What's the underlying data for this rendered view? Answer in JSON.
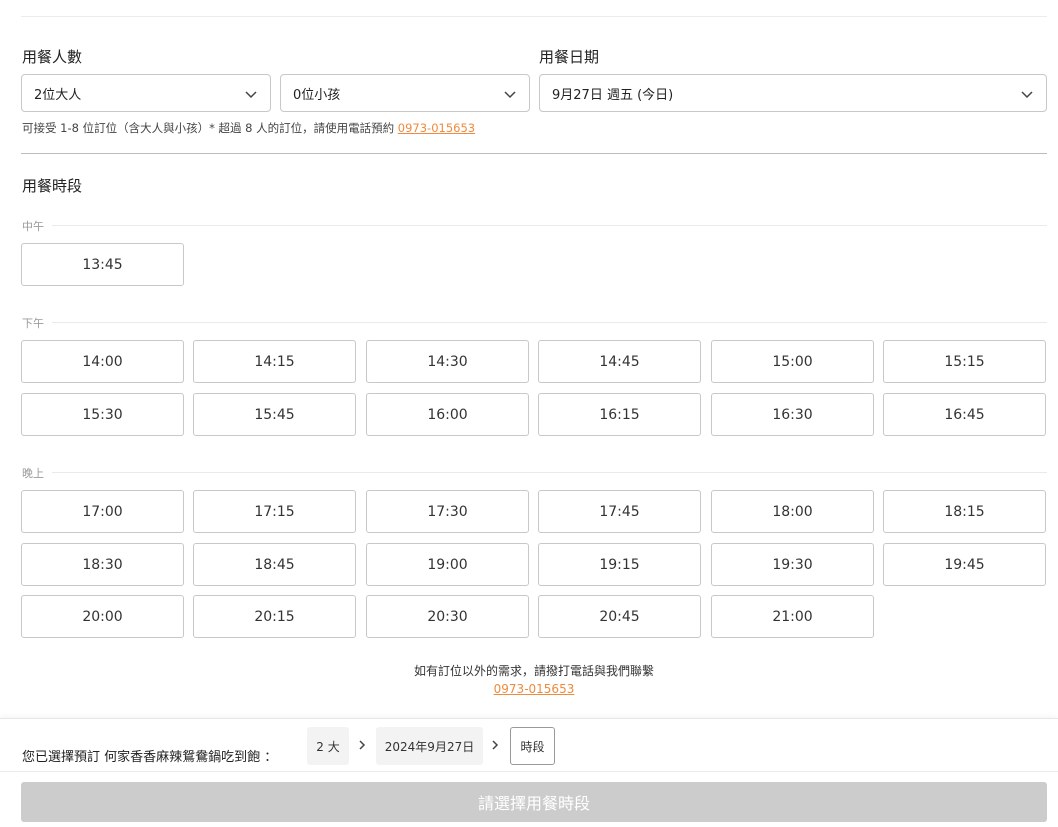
{
  "party": {
    "label": "用餐人數",
    "adults": "2位大人",
    "children": "0位小孩"
  },
  "date": {
    "label": "用餐日期",
    "value": "9月27日 週五 (今日)"
  },
  "notice": {
    "text": "可接受 1-8 位訂位（含大人與小孩）* 超過 8 人的訂位，請使用電話預約 ",
    "phone": "0973-015653"
  },
  "slots_section": {
    "title": "用餐時段",
    "periods": [
      {
        "label": "中午",
        "times": [
          "13:45"
        ]
      },
      {
        "label": "下午",
        "times": [
          "14:00",
          "14:15",
          "14:30",
          "14:45",
          "15:00",
          "15:15",
          "15:30",
          "15:45",
          "16:00",
          "16:15",
          "16:30",
          "16:45"
        ]
      },
      {
        "label": "晚上",
        "times": [
          "17:00",
          "17:15",
          "17:30",
          "17:45",
          "18:00",
          "18:15",
          "18:30",
          "18:45",
          "19:00",
          "19:15",
          "19:30",
          "19:45",
          "20:00",
          "20:15",
          "20:30",
          "20:45",
          "21:00"
        ]
      }
    ]
  },
  "contact": {
    "text": "如有訂位以外的需求，請撥打電話與我們聯繫",
    "phone": "0973-015653"
  },
  "summary_bar": {
    "prefix": "您已選擇預訂 何家香香麻辣鴛鴦鍋吃到飽 ：",
    "people": "2 大",
    "date": "2024年9月27日",
    "time": "時段",
    "confirm_label": "請選擇用餐時段"
  },
  "colors": {
    "accent_link": "#f08a3c",
    "disabled_button": "#cccccc"
  },
  "icons": {
    "dropdown": "chevron-down-icon",
    "step_arrow": "chevron-right-icon"
  }
}
